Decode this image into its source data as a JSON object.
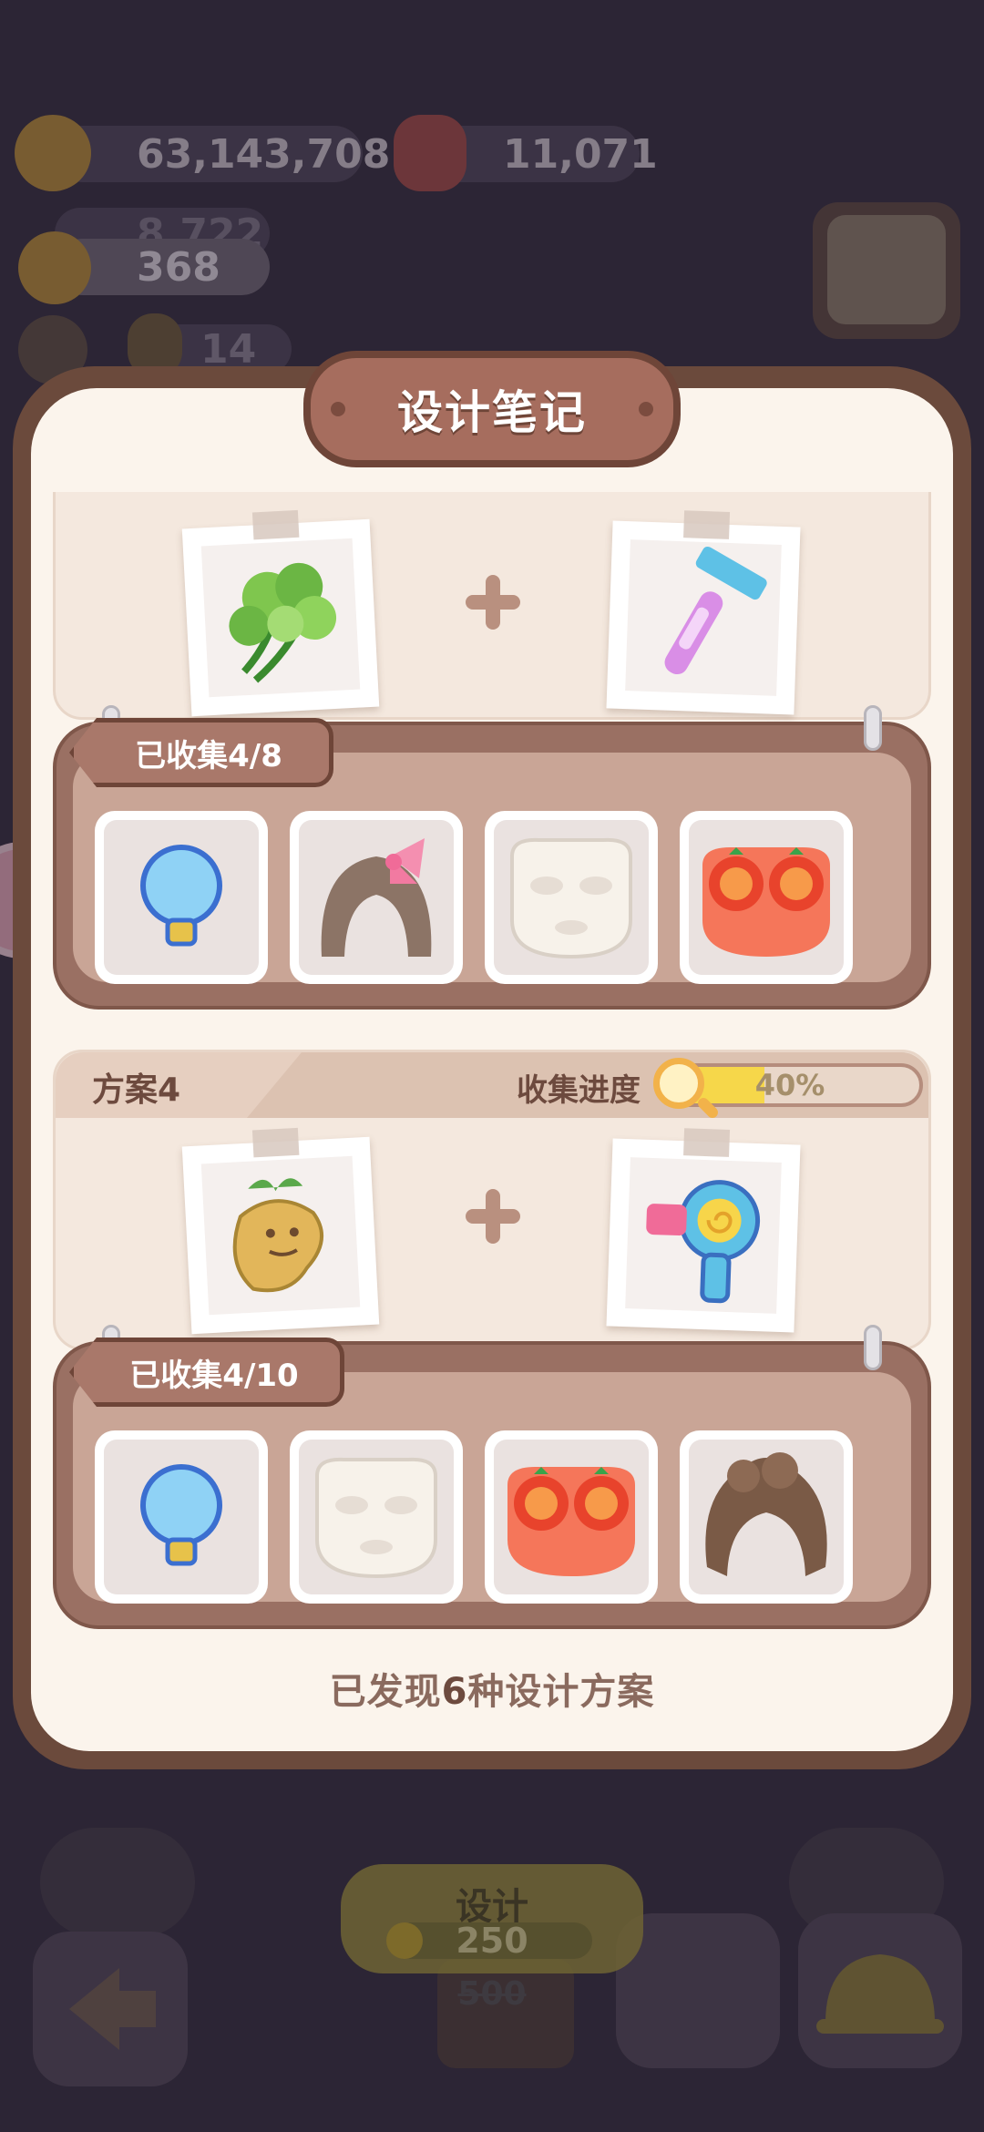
{
  "hud": {
    "coins": "63,143,708",
    "gems": "11,071",
    "hidden_counter": "8,722",
    "sunflowers": "368",
    "mini_count": "14"
  },
  "modal": {
    "title": "设计笔记",
    "footer_prefix": "已发现",
    "footer_count": "6",
    "footer_suffix": "种设计方案"
  },
  "plans": [
    {
      "ingredient_left": "parsley-icon",
      "ingredient_right": "razor-icon",
      "collected_label": "已收集4/8",
      "items": [
        "lightbulb-icon",
        "bow-hair-icon",
        "face-mask-icon",
        "tomato-mask-icon"
      ]
    },
    {
      "name": "方案4",
      "progress_label": "收集进度",
      "progress_percent": 40,
      "progress_text": "40%",
      "ingredient_left": "mandrake-icon",
      "ingredient_right": "hairdryer-icon",
      "collected_label": "已收集4/10",
      "items": [
        "lightbulb-icon",
        "face-mask-icon",
        "tomato-mask-icon",
        "mud-hair-icon"
      ]
    }
  ],
  "bottom": {
    "design_label": "设计",
    "cost": "250",
    "old_cost": "500"
  },
  "colors": {
    "frame": "#6b4a3c",
    "paper": "#fbf4ec",
    "progress_fill": "#f6d74a",
    "panel": "#9a7063"
  }
}
